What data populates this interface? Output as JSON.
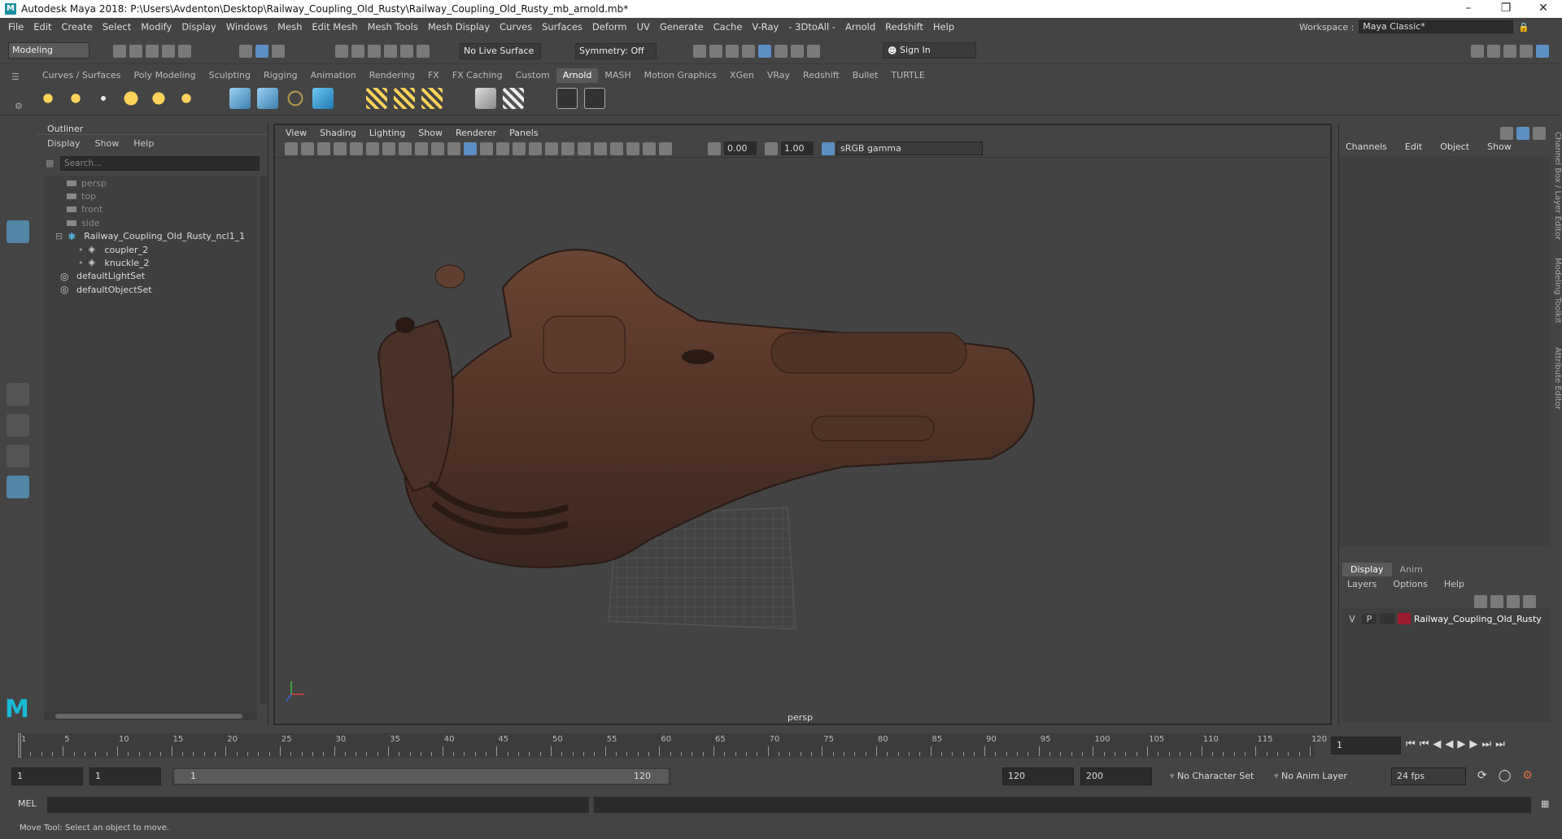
{
  "window": {
    "title": "Autodesk Maya 2018: P:\\Users\\Avdenton\\Desktop\\Railway_Coupling_Old_Rusty\\Railway_Coupling_Old_Rusty_mb_arnold.mb*"
  },
  "menubar": {
    "items": [
      "File",
      "Edit",
      "Create",
      "Select",
      "Modify",
      "Display",
      "Windows",
      "Mesh",
      "Edit Mesh",
      "Mesh Tools",
      "Mesh Display",
      "Curves",
      "Surfaces",
      "Deform",
      "UV",
      "Generate",
      "Cache",
      "V-Ray",
      "- 3DtoAll -",
      "Arnold",
      "Redshift",
      "Help"
    ],
    "workspace_label": "Workspace :",
    "workspace_value": "Maya Classic*"
  },
  "toolbar": {
    "mode": "Modeling",
    "live_surface": "No Live Surface",
    "symmetry": "Symmetry: Off",
    "sign_in": "Sign In"
  },
  "shelf": {
    "tabs": [
      "Curves / Surfaces",
      "Poly Modeling",
      "Sculpting",
      "Rigging",
      "Animation",
      "Rendering",
      "FX",
      "FX Caching",
      "Custom",
      "Arnold",
      "MASH",
      "Motion Graphics",
      "XGen",
      "VRay",
      "Redshift",
      "Bullet",
      "TURTLE"
    ],
    "active_tab": "Arnold"
  },
  "outliner": {
    "title": "Outliner",
    "menu": [
      "Display",
      "Show",
      "Help"
    ],
    "search_placeholder": "Search...",
    "items": [
      {
        "label": "persp",
        "type": "camera"
      },
      {
        "label": "top",
        "type": "camera"
      },
      {
        "label": "front",
        "type": "camera"
      },
      {
        "label": "side",
        "type": "camera"
      },
      {
        "label": "Railway_Coupling_Old_Rusty_ncl1_1",
        "type": "group"
      },
      {
        "label": "coupler_2",
        "type": "mesh"
      },
      {
        "label": "knuckle_2",
        "type": "mesh"
      },
      {
        "label": "defaultLightSet",
        "type": "set"
      },
      {
        "label": "defaultObjectSet",
        "type": "set"
      }
    ]
  },
  "viewport": {
    "menu": [
      "View",
      "Shading",
      "Lighting",
      "Show",
      "Renderer",
      "Panels"
    ],
    "exposure": "0.00",
    "gamma_value": "1.00",
    "color_space": "sRGB gamma",
    "camera_label": "persp"
  },
  "channel_box": {
    "menu": [
      "Channels",
      "Edit",
      "Object",
      "Show"
    ],
    "side_tabs": [
      "Channel Box / Layer Editor",
      "Modeling Toolkit",
      "Attribute Editor"
    ]
  },
  "layer_editor": {
    "tabs": [
      "Display",
      "Anim"
    ],
    "active_tab": "Display",
    "menu": [
      "Layers",
      "Options",
      "Help"
    ],
    "layer": {
      "v": "V",
      "p": "P",
      "name": "Railway_Coupling_Old_Rusty",
      "color": "#9b1b30"
    }
  },
  "timeline": {
    "ticks": [
      "1",
      "5",
      "10",
      "15",
      "20",
      "25",
      "30",
      "35",
      "40",
      "45",
      "50",
      "55",
      "60",
      "65",
      "70",
      "75",
      "80",
      "85",
      "90",
      "95",
      "100",
      "105",
      "110",
      "115",
      "120"
    ],
    "current_frame": "1"
  },
  "range": {
    "start": "1",
    "playback_start": "1",
    "slider_start": "1",
    "slider_end": "120",
    "playback_end": "120",
    "end": "200",
    "character_set": "No Character Set",
    "anim_layer": "No Anim Layer",
    "fps": "24 fps"
  },
  "command_line": {
    "label": "MEL"
  },
  "status": {
    "text": "Move Tool: Select an object to move."
  },
  "colors": {
    "accent": "#5285a6",
    "rust": "#5a3a2c",
    "layer": "#9b1b30"
  }
}
